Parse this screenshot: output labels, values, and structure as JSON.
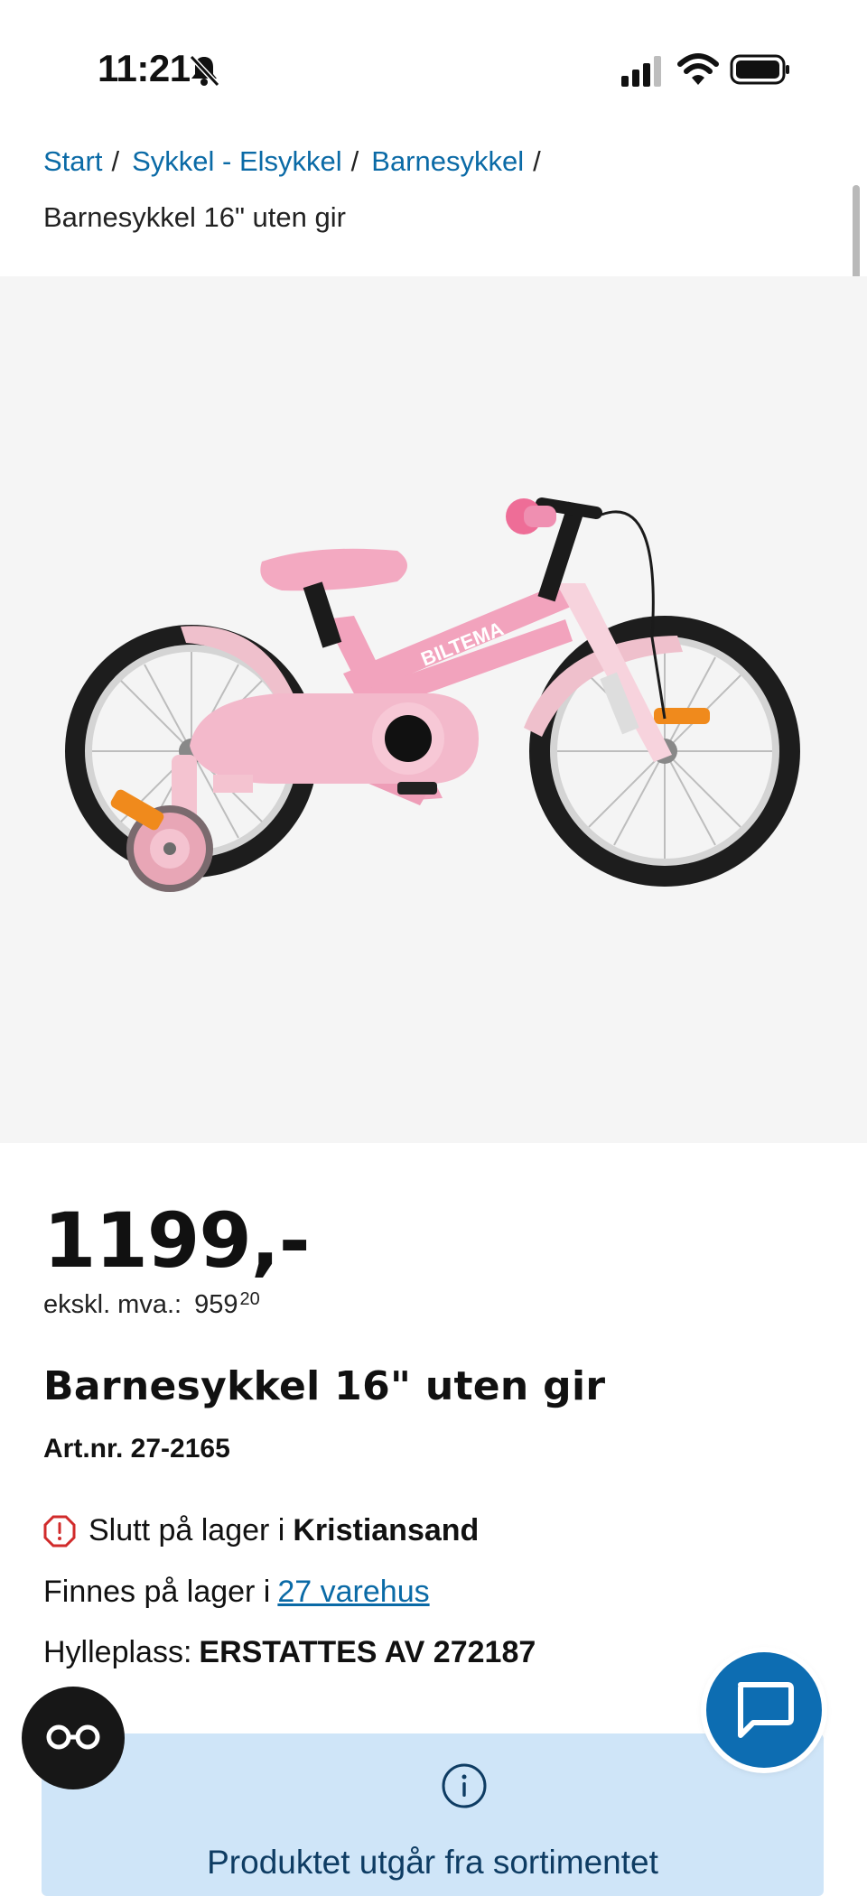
{
  "status_bar": {
    "time": "11:21"
  },
  "breadcrumb": {
    "items": [
      "Start",
      "Sykkel - Elsykkel",
      "Barnesykkel"
    ],
    "separator": "/",
    "current": "Barnesykkel 16\" uten gir"
  },
  "product": {
    "price": "1199,-",
    "ex_vat_label": "ekskl. mva.:",
    "ex_vat_whole": "959",
    "ex_vat_decimals": "20",
    "title": "Barnesykkel 16\" uten gir",
    "art_nr": "Art.nr. 27-2165",
    "bike_brand_text": "BILTEMA"
  },
  "stock": {
    "out_of_stock_text": "Slutt på lager i",
    "store": "Kristiansand",
    "available_text": "Finnes på lager i",
    "warehouses_link": "27 varehus",
    "shelf_label": "Hylleplass:",
    "shelf_value": "ERSTATTES AV 272187"
  },
  "notice": {
    "text": "Produktet utgår fra sortimentet"
  },
  "icons": {
    "bell": "bell-muted-icon",
    "signal": "cellular-signal-icon",
    "wifi": "wifi-icon",
    "battery": "battery-icon",
    "warning": "warning-octagon-icon",
    "info": "info-circle-icon",
    "chat": "chat-bubble-icon",
    "glasses": "glasses-icon"
  },
  "colors": {
    "link": "#0a6aa6",
    "warning": "#d12b2b",
    "notice_bg": "#cfe5f8",
    "chat_button": "#0d6db2",
    "bike_pink": "#f2b7c8"
  }
}
